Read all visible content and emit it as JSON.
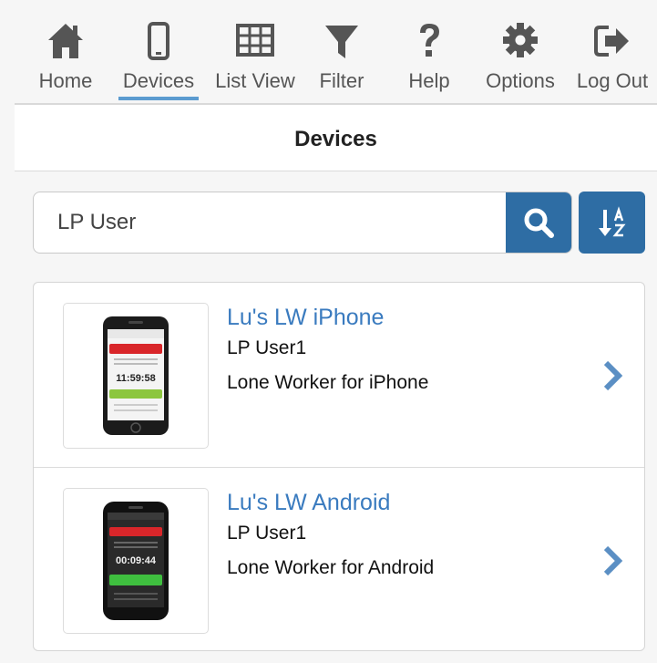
{
  "nav": {
    "items": [
      {
        "label": "Home",
        "icon": "home-icon"
      },
      {
        "label": "Devices",
        "icon": "mobile-icon",
        "active": true
      },
      {
        "label": "List View",
        "icon": "grid-icon"
      },
      {
        "label": "Filter",
        "icon": "filter-icon"
      },
      {
        "label": "Help",
        "icon": "question-icon"
      },
      {
        "label": "Options",
        "icon": "gear-icon"
      },
      {
        "label": "Log Out",
        "icon": "logout-icon"
      }
    ]
  },
  "page": {
    "title": "Devices"
  },
  "search": {
    "value": "LP User",
    "button_icon": "search-icon",
    "sort_icon": "sort-alpha-icon"
  },
  "devices": [
    {
      "name": "Lu's LW iPhone",
      "user": "LP User1",
      "type": "Lone Worker for iPhone",
      "screen_time": "11:59:58"
    },
    {
      "name": "Lu's LW Android",
      "user": "LP User1",
      "type": "Lone Worker for Android",
      "screen_time": "00:09:44"
    }
  ],
  "colors": {
    "accent": "#2e6da4",
    "link": "#3a7bbf",
    "active_underline": "#5b9bd0",
    "icon": "#555555"
  }
}
